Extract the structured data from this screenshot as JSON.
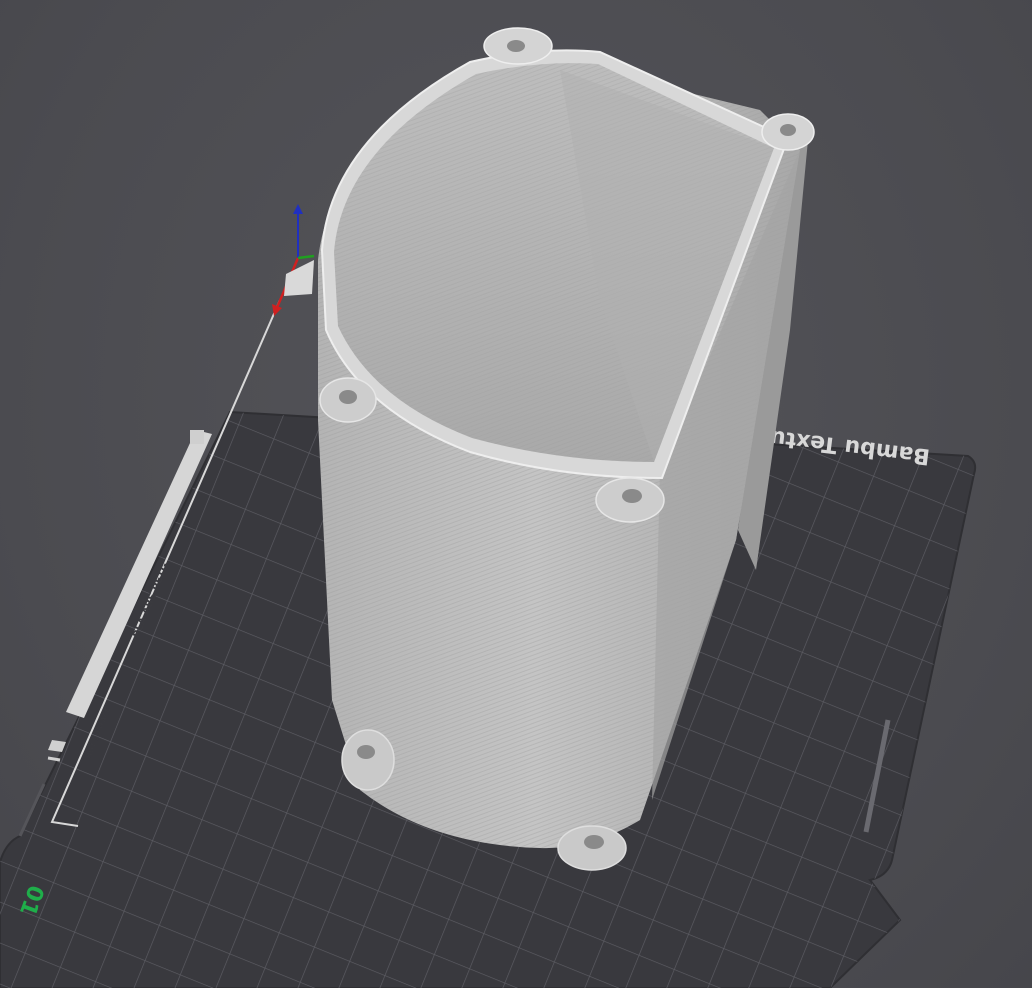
{
  "viewport": {
    "background_color": "#4d4d52",
    "plate_color": "#3a3a3f",
    "grid_color": "#5f5f66",
    "model_color": "#c0c0c0"
  },
  "plate": {
    "brand_text": "Bambu Textured",
    "filament_text": "PLA ABS PETG",
    "surface_text": "HOT SURFACE",
    "plate_number": "01",
    "plate_number_color": "#1fae4a"
  },
  "axes": {
    "x_color": "#d02020",
    "y_color": "#20a020",
    "z_color": "#2030c0"
  },
  "model": {
    "name": "hollow-cylinder-enclosure"
  }
}
